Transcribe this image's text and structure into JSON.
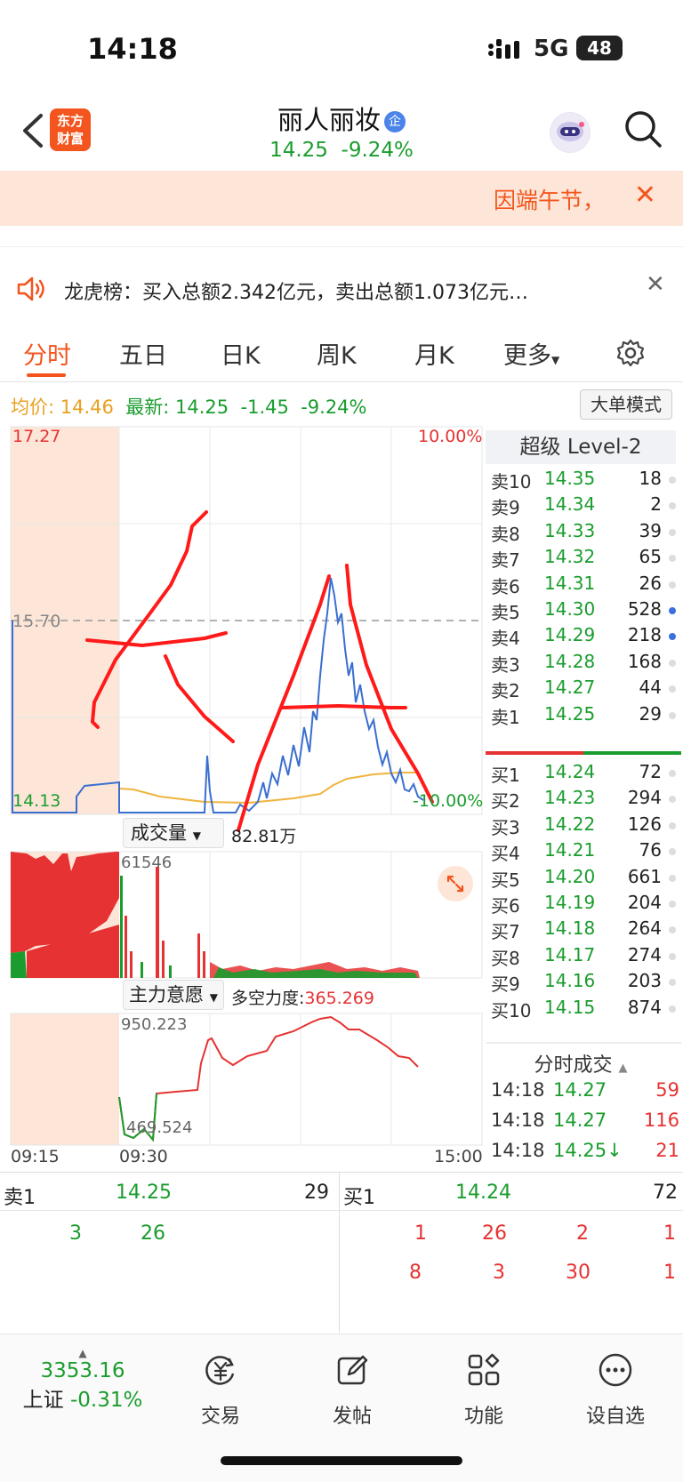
{
  "status": {
    "time": "14:18",
    "network": "5G",
    "battery": "48"
  },
  "header": {
    "title": "丽人丽妆",
    "badge": "企",
    "price": "14.25",
    "change_pct": "-9.24%",
    "logo_line1": "东方",
    "logo_line2": "财富"
  },
  "banner": {
    "text": "因端午节，",
    "close": "✕"
  },
  "notice": {
    "text": "龙虎榜：买入总额2.342亿元，卖出总额1.073亿元…",
    "close": "✕"
  },
  "tabs": [
    "分时",
    "五日",
    "日K",
    "周K",
    "月K",
    "更多"
  ],
  "summary": {
    "avg_label": "均价:",
    "avg_value": "14.46",
    "last_label": "最新:",
    "last_value": "14.25",
    "change": "-1.45",
    "change_pct": "-9.24%",
    "big_mode": "大单模式"
  },
  "chart": {
    "y_max": "17.27",
    "y_mid": "15.70",
    "y_min": "14.13",
    "pct_max": "10.00%",
    "pct_min": "-10.00%",
    "volume_label": "成交量",
    "volume_value": "82.81万",
    "volume_max": "61546",
    "force_label": "主力意愿",
    "force_metric_label": "多空力度:",
    "force_metric_value": "365.269",
    "force_max": "950.223",
    "force_min": "469.524",
    "time_start": "09:15",
    "time_open": "09:30",
    "time_end": "15:00"
  },
  "level2": {
    "title": "超级 Level-2",
    "asks": [
      {
        "label": "卖10",
        "price": "14.35",
        "qty": "18",
        "dot": "gray"
      },
      {
        "label": "卖9",
        "price": "14.34",
        "qty": "2",
        "dot": "gray"
      },
      {
        "label": "卖8",
        "price": "14.33",
        "qty": "39",
        "dot": "gray"
      },
      {
        "label": "卖7",
        "price": "14.32",
        "qty": "65",
        "dot": "gray"
      },
      {
        "label": "卖6",
        "price": "14.31",
        "qty": "26",
        "dot": "gray"
      },
      {
        "label": "卖5",
        "price": "14.30",
        "qty": "528",
        "dot": "blue"
      },
      {
        "label": "卖4",
        "price": "14.29",
        "qty": "218",
        "dot": "blue"
      },
      {
        "label": "卖3",
        "price": "14.28",
        "qty": "168",
        "dot": "gray"
      },
      {
        "label": "卖2",
        "price": "14.27",
        "qty": "44",
        "dot": "gray"
      },
      {
        "label": "卖1",
        "price": "14.25",
        "qty": "29",
        "dot": "gray"
      }
    ],
    "bids": [
      {
        "label": "买1",
        "price": "14.24",
        "qty": "72",
        "dot": "gray"
      },
      {
        "label": "买2",
        "price": "14.23",
        "qty": "294",
        "dot": "gray"
      },
      {
        "label": "买3",
        "price": "14.22",
        "qty": "126",
        "dot": "gray"
      },
      {
        "label": "买4",
        "price": "14.21",
        "qty": "76",
        "dot": "gray"
      },
      {
        "label": "买5",
        "price": "14.20",
        "qty": "661",
        "dot": "gray"
      },
      {
        "label": "买6",
        "price": "14.19",
        "qty": "204",
        "dot": "gray"
      },
      {
        "label": "买7",
        "price": "14.18",
        "qty": "264",
        "dot": "gray"
      },
      {
        "label": "买8",
        "price": "14.17",
        "qty": "274",
        "dot": "gray"
      },
      {
        "label": "买9",
        "price": "14.16",
        "qty": "203",
        "dot": "gray"
      },
      {
        "label": "买10",
        "price": "14.15",
        "qty": "874",
        "dot": "gray"
      }
    ],
    "ticks_title": "分时成交",
    "ticks": [
      {
        "time": "14:18",
        "price": "14.27",
        "qty": "59"
      },
      {
        "time": "14:18",
        "price": "14.27",
        "qty": "116"
      },
      {
        "time": "14:18",
        "price": "14.25↓",
        "qty": "21"
      }
    ]
  },
  "bottom_book": {
    "ask_label": "卖1",
    "ask_price": "14.25",
    "ask_qty": "29",
    "bid_label": "买1",
    "bid_price": "14.24",
    "bid_qty": "72",
    "ask_details": [
      "3",
      "26"
    ],
    "bid_details_row1": [
      "1",
      "26",
      "2",
      "1"
    ],
    "bid_details_row2": [
      "8",
      "3",
      "30",
      "1"
    ]
  },
  "nav": {
    "index_value": "3353.16",
    "index_name": "上证",
    "index_change": "-0.31%",
    "items": [
      "交易",
      "发帖",
      "功能",
      "设自选"
    ]
  },
  "colors": {
    "accent": "#f4541d",
    "down": "#1a9d2e",
    "up": "#e63232",
    "price_line": "#3a6fd0",
    "avg_line": "#f0b43c",
    "annotation": "#ff1a1a"
  }
}
